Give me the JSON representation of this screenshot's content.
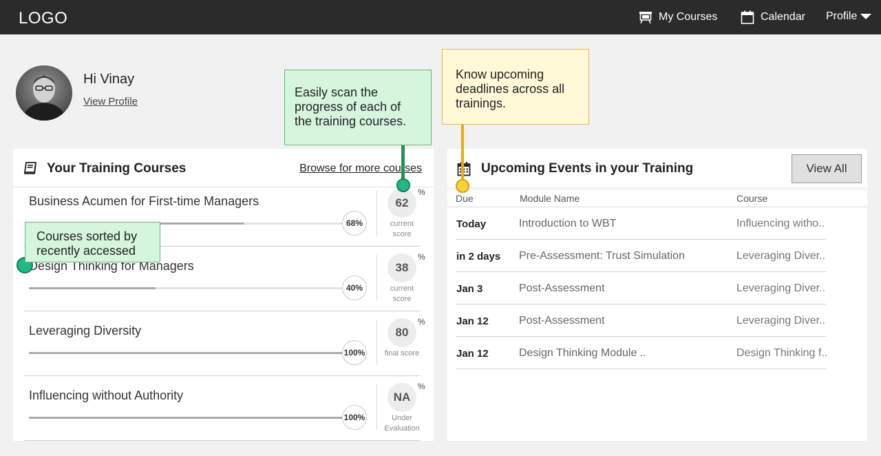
{
  "header": {
    "logo": "LOGO",
    "nav": {
      "my_courses": "My Courses",
      "calendar": "Calendar",
      "profile": "Profile"
    }
  },
  "user": {
    "greeting": "Hi Vinay",
    "view_profile": "View Profile"
  },
  "training": {
    "title": "Your Training Courses",
    "browse_link": "Browse for more courses",
    "courses": [
      {
        "name": "Business Acumen for First-time Managers",
        "progress_label": "68%",
        "progress_fraction": 0.68,
        "score": "62",
        "score_unit": "%",
        "score_label": "current score"
      },
      {
        "name": "Design Thinking for Managers",
        "progress_label": "40%",
        "progress_fraction": 0.4,
        "score": "38",
        "score_unit": "%",
        "score_label": "current score"
      },
      {
        "name": "Leveraging Diversity",
        "progress_label": "100%",
        "progress_fraction": 1.0,
        "score": "80",
        "score_unit": "%",
        "score_label": "final score"
      },
      {
        "name": "Influencing without Authority",
        "progress_label": "100%",
        "progress_fraction": 1.0,
        "score": "NA",
        "score_unit": "%",
        "score_label": "Under Evaluation"
      }
    ]
  },
  "events": {
    "title": "Upcoming Events in your Training",
    "view_all": "View All",
    "columns": {
      "due": "Due",
      "module": "Module Name",
      "course": "Course"
    },
    "rows": [
      {
        "due": "Today",
        "module": "Introduction to WBT",
        "course": "Influencing witho.."
      },
      {
        "due": "in 2 days",
        "module": "Pre-Assessment: Trust Simulation",
        "course": "Leveraging Diver.."
      },
      {
        "due": "Jan 3",
        "module": "Post-Assessment",
        "course": "Leveraging Diver.."
      },
      {
        "due": "Jan 12",
        "module": "Post-Assessment",
        "course": "Leveraging Diver.."
      },
      {
        "due": "Jan 12",
        "module": "Design Thinking Module ..",
        "course": "Design Thinking f.."
      }
    ]
  },
  "callouts": {
    "progress": "Easily scan the progress of each of the training courses.",
    "deadlines": "Know upcoming deadlines across all trainings.",
    "sorted": "Courses sorted by recently accessed"
  },
  "colors": {
    "topbar": "#2b2b2b",
    "callout_green": "#d5f5dd",
    "callout_yellow": "#fff9d8",
    "dot_green": "#1fb985",
    "dot_yellow": "#f7d33a"
  }
}
